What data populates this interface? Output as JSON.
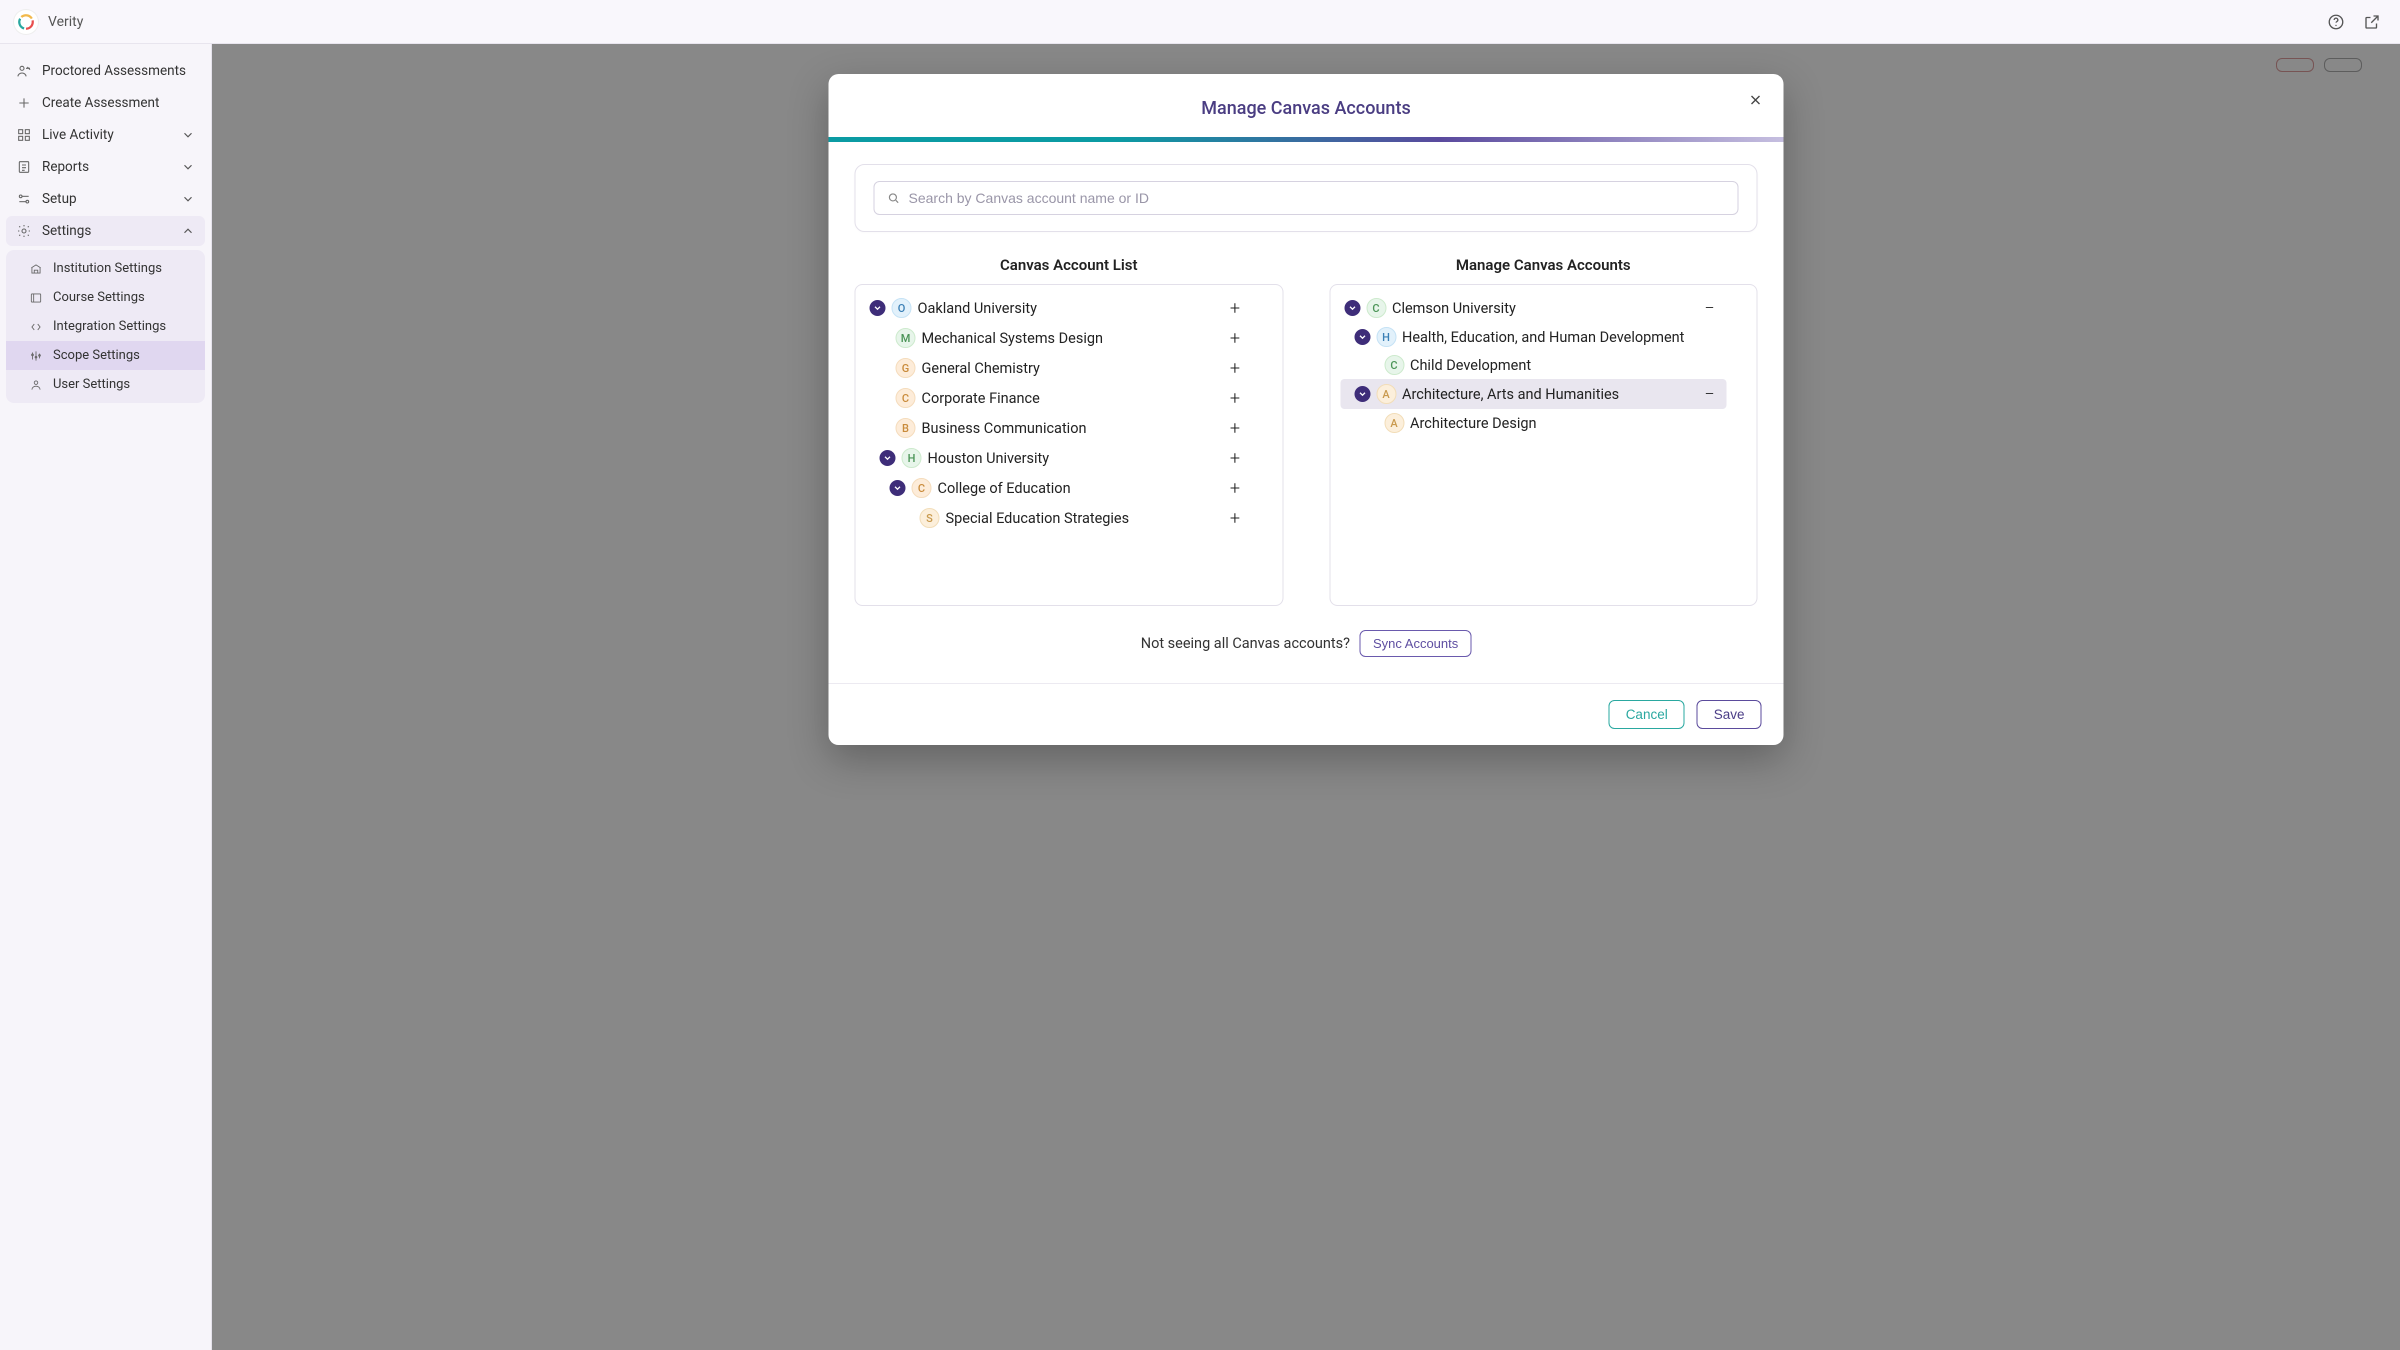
{
  "app": {
    "name": "Verity"
  },
  "sidebar": {
    "items": [
      {
        "label": "Proctored Assessments"
      },
      {
        "label": "Create Assessment"
      },
      {
        "label": "Live Activity"
      },
      {
        "label": "Reports"
      },
      {
        "label": "Setup"
      },
      {
        "label": "Settings"
      }
    ],
    "settings_sub": [
      {
        "label": "Institution Settings"
      },
      {
        "label": "Course Settings"
      },
      {
        "label": "Integration Settings"
      },
      {
        "label": "Scope Settings"
      },
      {
        "label": "User Settings"
      }
    ]
  },
  "modal": {
    "title": "Manage Canvas Accounts",
    "search": {
      "placeholder": "Search by Canvas account name or ID"
    },
    "left_title": "Canvas Account List",
    "right_title": "Manage Canvas Accounts",
    "left_tree": [
      {
        "indent": 0,
        "caret": true,
        "badge": "O",
        "badge_color": "c-blue",
        "name": "Oakland University",
        "action": "+"
      },
      {
        "indent": 1,
        "caret": false,
        "badge": "M",
        "badge_color": "c-green",
        "name": "Mechanical Systems Design",
        "action": "+"
      },
      {
        "indent": 1,
        "caret": false,
        "badge": "G",
        "badge_color": "c-orange",
        "name": "General Chemistry",
        "action": "+"
      },
      {
        "indent": 1,
        "caret": false,
        "badge": "C",
        "badge_color": "c-orange",
        "name": "Corporate Finance",
        "action": "+"
      },
      {
        "indent": 1,
        "caret": false,
        "badge": "B",
        "badge_color": "c-orange",
        "name": "Business Communication",
        "action": "+"
      },
      {
        "indent": 0,
        "caret": true,
        "badge": "H",
        "badge_color": "c-green",
        "name": "Houston University",
        "action": "+",
        "caret_indent": 1
      },
      {
        "indent": 1,
        "caret": true,
        "badge": "C",
        "badge_color": "c-orange",
        "name": "College of Education",
        "action": "+",
        "caret_indent": 2
      },
      {
        "indent": 2,
        "caret": false,
        "badge": "S",
        "badge_color": "c-tan",
        "name": "Special Education Strategies",
        "action": "+"
      }
    ],
    "right_tree": [
      {
        "indent": 0,
        "caret": true,
        "badge": "C",
        "badge_color": "c-green",
        "name": "Clemson University",
        "action": "−"
      },
      {
        "indent": 1,
        "caret": true,
        "badge": "H",
        "badge_color": "c-blue",
        "name": "Health, Education, and Human Development",
        "action": ""
      },
      {
        "indent": 2,
        "caret": false,
        "badge": "C",
        "badge_color": "c-green",
        "name": "Child Development",
        "action": ""
      },
      {
        "indent": 1,
        "caret": true,
        "badge": "A",
        "badge_color": "c-tan",
        "name": "Architecture, Arts and Humanities",
        "action": "−",
        "highlight": true
      },
      {
        "indent": 2,
        "caret": false,
        "badge": "A",
        "badge_color": "c-tan",
        "name": "Architecture Design",
        "action": ""
      }
    ],
    "sync_prompt": "Not seeing all Canvas accounts?",
    "sync_button": "Sync Accounts",
    "footer": {
      "cancel": "Cancel",
      "save": "Save"
    }
  }
}
